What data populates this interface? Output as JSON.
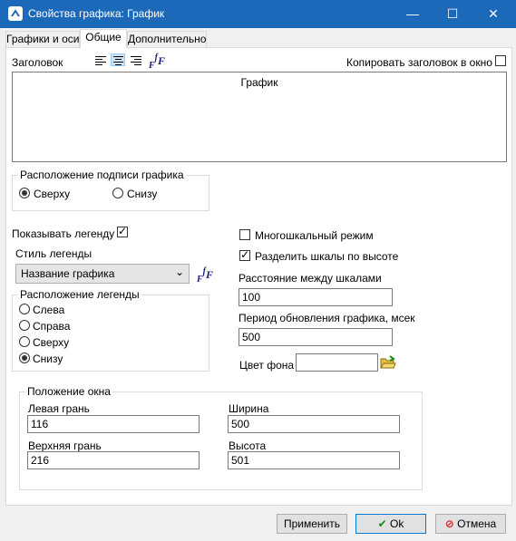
{
  "window": {
    "title": "Свойства графика: График",
    "minimize": "—",
    "maximize": "☐",
    "close": "✕"
  },
  "tabs": [
    {
      "label": "Графики и оси",
      "active": false
    },
    {
      "label": "Общие",
      "active": true
    },
    {
      "label": "Дополнительно",
      "active": false
    }
  ],
  "title_section": {
    "label": "Заголовок",
    "copy_to_window_label": "Копировать заголовок в окно",
    "copy_to_window_checked": false,
    "text": "График"
  },
  "caption_position": {
    "group_label": "Расположение подписи графика",
    "options": [
      "Сверху",
      "Снизу"
    ],
    "selected": "Сверху"
  },
  "legend": {
    "show_label": "Показывать легенду",
    "show_checked": true,
    "style_label": "Стиль легенды",
    "style_value": "Название графика",
    "position_group_label": "Расположение легенды",
    "position_options": [
      "Слева",
      "Справа",
      "Сверху",
      "Снизу"
    ],
    "position_selected": "Снизу"
  },
  "scales": {
    "multiscale_label": "Многошкальный режим",
    "multiscale_checked": false,
    "split_label": "Разделить шкалы по высоте",
    "split_checked": true,
    "distance_label": "Расстояние между шкалами",
    "distance_value": "100",
    "refresh_label": "Период обновления графика, мсек",
    "refresh_value": "500",
    "bg_color_label": "Цвет фона",
    "bg_color_value": ""
  },
  "window_position": {
    "group_label": "Положение окна",
    "left_label": "Левая грань",
    "left_value": "116",
    "width_label": "Ширина",
    "width_value": "500",
    "top_label": "Верхняя грань",
    "top_value": "216",
    "height_label": "Высота",
    "height_value": "501"
  },
  "buttons": {
    "apply": "Применить",
    "ok": "Ok",
    "cancel": "Отмена"
  },
  "fx_icon_text": "F",
  "fx_icon_sup": "f",
  "colors": {
    "titlebar": "#1c69ba",
    "ok_check": "#1a8a1a",
    "cancel_icon": "#d02020",
    "folder": "#e8c040"
  }
}
